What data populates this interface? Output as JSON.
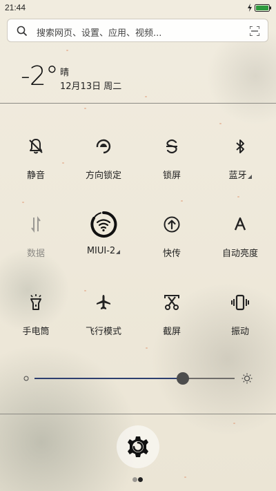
{
  "status_bar": {
    "time": "21:44",
    "battery_color": "#2e9a3e"
  },
  "search": {
    "placeholder": "搜索网页、设置、应用、视频..."
  },
  "weather": {
    "temperature": "-2°",
    "condition": "晴",
    "date": "12月13日 周二"
  },
  "toggles": [
    {
      "label": "静音",
      "icon": "bell-slash-icon",
      "active": false
    },
    {
      "label": "方向锁定",
      "icon": "rotation-lock-icon",
      "active": false
    },
    {
      "label": "锁屏",
      "icon": "lock-screen-icon",
      "active": false
    },
    {
      "label": "蓝牙",
      "icon": "bluetooth-icon",
      "active": false,
      "has_submenu": true
    },
    {
      "label": "数据",
      "icon": "mobile-data-icon",
      "active": false,
      "disabled": true
    },
    {
      "label": "MIUI-2",
      "icon": "wifi-icon",
      "active": true,
      "has_submenu": true
    },
    {
      "label": "快传",
      "icon": "quick-transfer-icon",
      "active": false
    },
    {
      "label": "自动亮度",
      "icon": "auto-brightness-icon",
      "active": false
    },
    {
      "label": "手电筒",
      "icon": "flashlight-icon",
      "active": false
    },
    {
      "label": "飞行模式",
      "icon": "airplane-icon",
      "active": false
    },
    {
      "label": "截屏",
      "icon": "screenshot-icon",
      "active": false
    },
    {
      "label": "振动",
      "icon": "vibrate-icon",
      "active": false
    }
  ],
  "brightness": {
    "level": 0.74,
    "track_fill_color": "#2c3e6e"
  },
  "pager": {
    "count": 2,
    "current": 2
  }
}
